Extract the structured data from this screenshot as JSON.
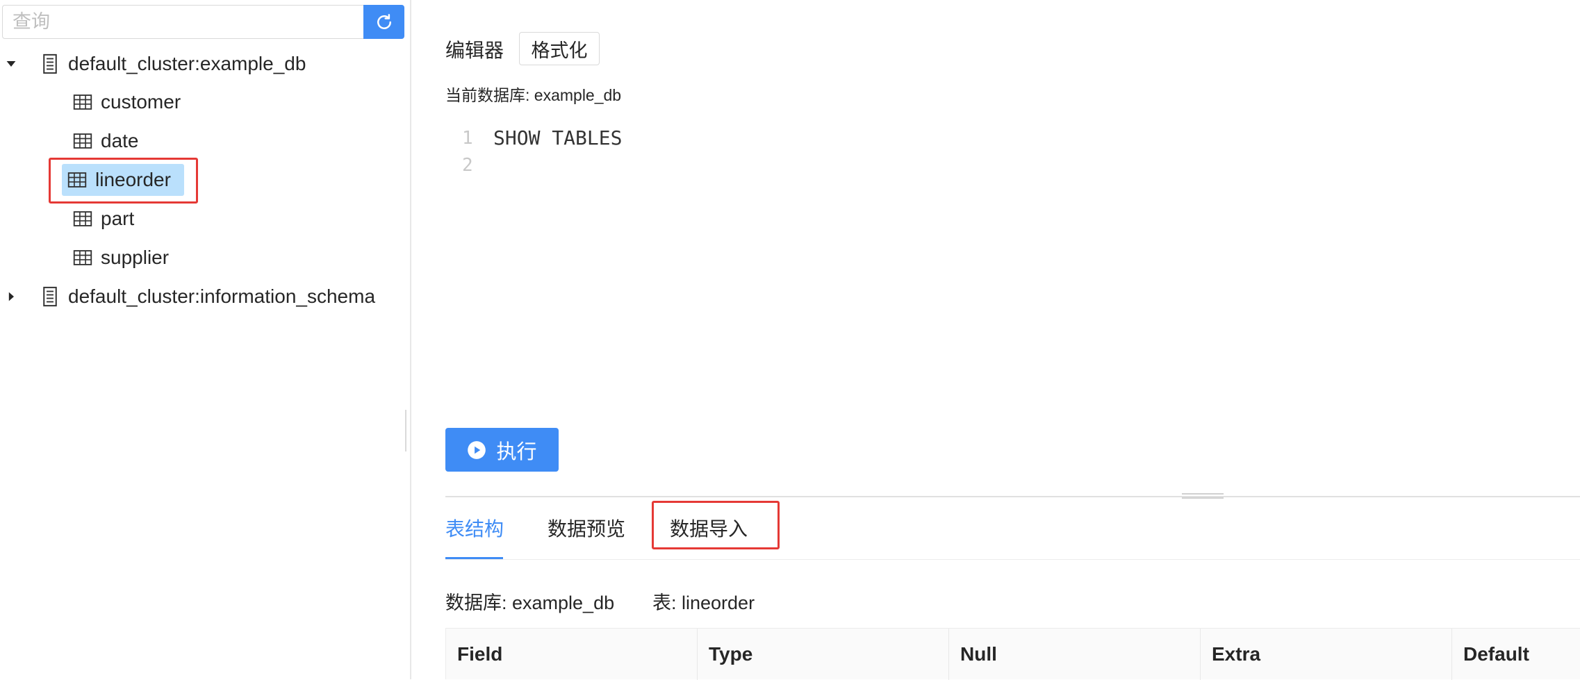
{
  "sidebar": {
    "search_placeholder": "查询",
    "tree": {
      "db1": {
        "label": "default_cluster:example_db",
        "tables": [
          "customer",
          "date",
          "lineorder",
          "part",
          "supplier"
        ]
      },
      "db2": {
        "label": "default_cluster:information_schema"
      }
    }
  },
  "editor": {
    "label": "编辑器",
    "format_label": "格式化",
    "current_db": "当前数据库: example_db",
    "line_numbers": [
      "1",
      "2"
    ],
    "lines": [
      "SHOW TABLES",
      ""
    ]
  },
  "run_button": {
    "label": "执行"
  },
  "tabs": [
    "表结构",
    "数据预览",
    "数据导入"
  ],
  "info": {
    "database": "数据库: example_db",
    "table": "表: lineorder"
  },
  "schema_table": {
    "columns": [
      "Field",
      "Type",
      "Null",
      "Extra",
      "Default"
    ]
  },
  "colors": {
    "accent": "#3f8cf5",
    "selected_row": "#bae0fc",
    "highlight_box": "#e53935"
  }
}
